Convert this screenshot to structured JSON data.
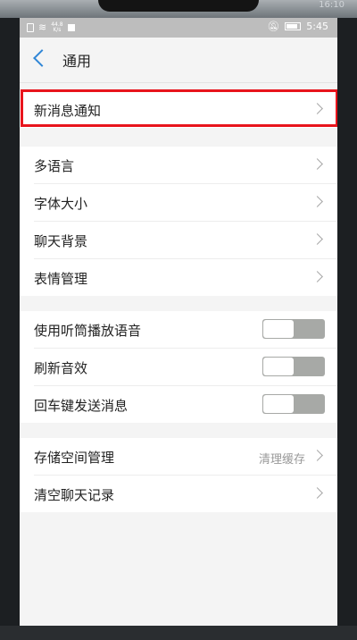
{
  "device": {
    "top_clock": "16:10"
  },
  "statusbar": {
    "speed": "44.8\nK/s",
    "time": "5:45"
  },
  "header": {
    "title": "通用"
  },
  "groups": [
    {
      "rows": [
        {
          "label": "新消息通知",
          "control": "chevron",
          "highlighted": true
        }
      ]
    },
    {
      "rows": [
        {
          "label": "多语言",
          "control": "chevron"
        },
        {
          "label": "字体大小",
          "control": "chevron"
        },
        {
          "label": "聊天背景",
          "control": "chevron"
        },
        {
          "label": "表情管理",
          "control": "chevron"
        }
      ]
    },
    {
      "rows": [
        {
          "label": "使用听筒播放语音",
          "control": "toggle",
          "on": false
        },
        {
          "label": "刷新音效",
          "control": "toggle",
          "on": false
        },
        {
          "label": "回车键发送消息",
          "control": "toggle",
          "on": false
        }
      ]
    },
    {
      "rows": [
        {
          "label": "存储空间管理",
          "value": "清理缓存",
          "control": "chevron"
        },
        {
          "label": "清空聊天记录",
          "control": "chevron"
        }
      ]
    }
  ],
  "colors": {
    "accent": "#2f86d6",
    "highlight": "#e8141c",
    "toggle_off": "#a7a9a6"
  }
}
